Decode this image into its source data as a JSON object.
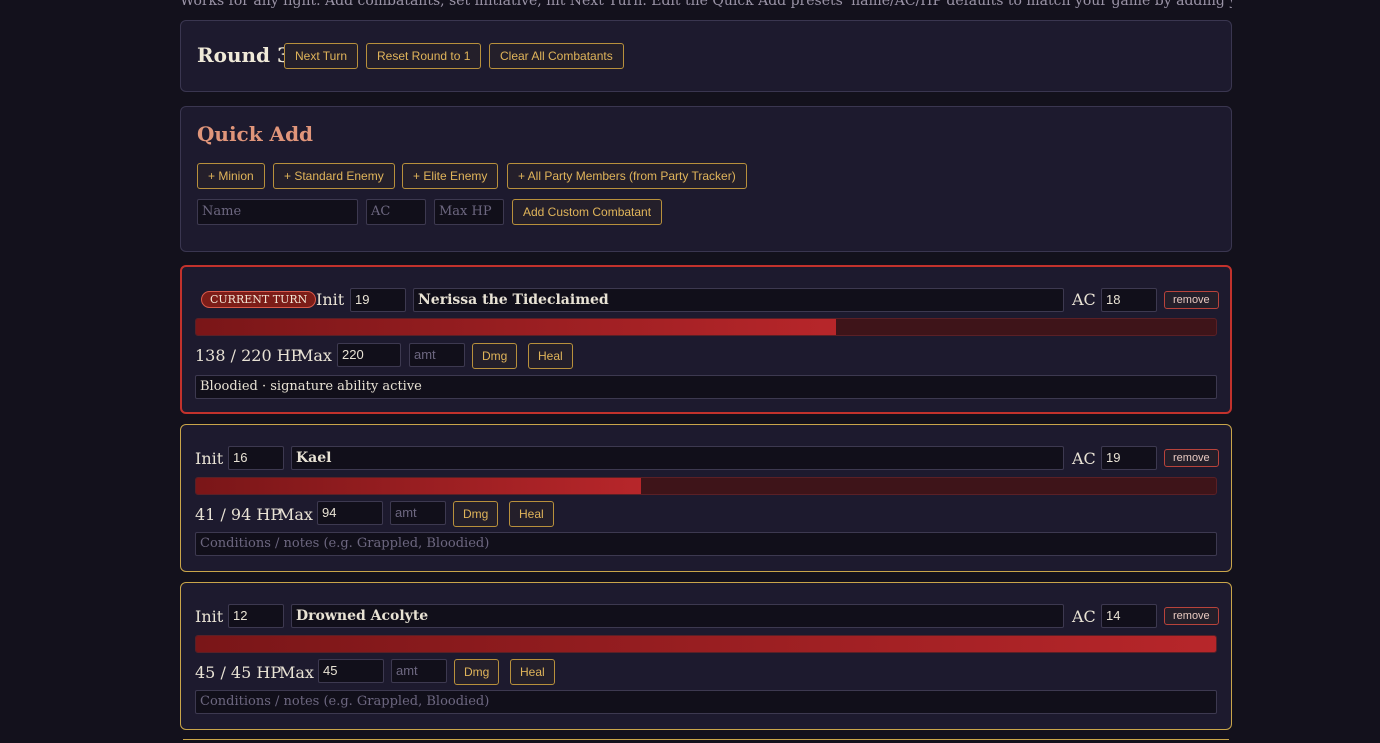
{
  "intro_text": "Works for any fight. Add combatants, set initiative, hit Next Turn. Edit the Quick Add presets' name/AC/HP defaults to match your game by adding your own custom combatants below.",
  "round": {
    "title": "Round 3",
    "next_turn_label": "Next Turn",
    "reset_label": "Reset Round to 1",
    "clear_label": "Clear All Combatants"
  },
  "quick_add": {
    "title": "Quick Add",
    "presets": [
      "+ Minion",
      "+ Standard Enemy",
      "+ Elite Enemy",
      "+ All Party Members (from Party Tracker)"
    ],
    "name_placeholder": "Name",
    "ac_placeholder": "AC",
    "hp_placeholder": "Max HP",
    "add_label": "Add Custom Combatant"
  },
  "labels": {
    "current_turn": "CURRENT TURN",
    "init": "Init",
    "ac": "AC",
    "max": "Max",
    "remove": "remove",
    "dmg": "Dmg",
    "heal": "Heal",
    "amt_placeholder": "amt",
    "notes_placeholder": "Conditions / notes (e.g. Grappled, Bloodied)"
  },
  "combatants": [
    {
      "init": "19",
      "name": "Nerissa the Tideclaimed",
      "ac": "18",
      "hp_text": "138 / 220 HP",
      "max": "220",
      "hp_fraction": 0.627,
      "notes": "Bloodied · signature ability active",
      "current": true
    },
    {
      "init": "16",
      "name": "Kael",
      "ac": "19",
      "hp_text": "41 / 94 HP",
      "max": "94",
      "hp_fraction": 0.436,
      "notes": "",
      "current": false
    },
    {
      "init": "12",
      "name": "Drowned Acolyte",
      "ac": "14",
      "hp_text": "45 / 45 HP",
      "max": "45",
      "hp_fraction": 1.0,
      "notes": "",
      "current": false
    }
  ],
  "colors": {
    "accent": "#e0b45a",
    "current_border": "#c2322c",
    "hp_bar": "#b7262a"
  }
}
